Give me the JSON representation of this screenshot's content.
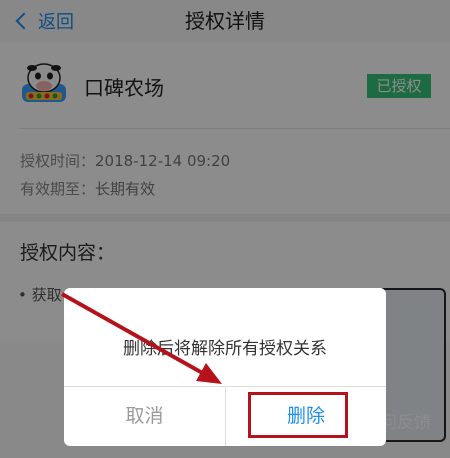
{
  "navbar": {
    "back_label": "返回",
    "title": "授权详情"
  },
  "app": {
    "name": "口碑农场",
    "status_badge": "已授权",
    "logo_icon": "cow-logo-icon"
  },
  "info": {
    "auth_time_label": "授权时间：",
    "auth_time_value": "2018-12-14 09:20",
    "valid_until_label": "有效期至：",
    "valid_until_value": "长期有效"
  },
  "section": {
    "title": "授权内容：",
    "bullet_text": "• 获取"
  },
  "bottom": {
    "feedback_label": "问反馈"
  },
  "dialog": {
    "message": "删除后将解除所有授权关系",
    "cancel_label": "取消",
    "delete_label": "删除"
  },
  "colors": {
    "accent": "#1f8ef1",
    "badge": "#33c37a",
    "annotation": "#b5121b"
  }
}
